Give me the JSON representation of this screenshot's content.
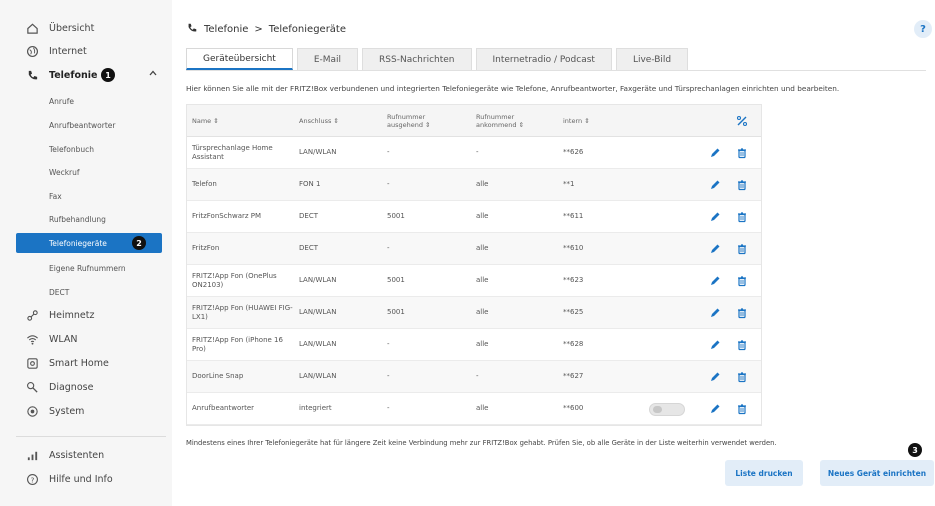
{
  "sidebar": {
    "items": [
      {
        "label": "Übersicht",
        "icon": "home-icon"
      },
      {
        "label": "Internet",
        "icon": "globe-icon"
      },
      {
        "label": "Telefonie",
        "icon": "phone-icon",
        "badge": "1"
      },
      {
        "label": "Heimnetz",
        "icon": "network-icon"
      },
      {
        "label": "WLAN",
        "icon": "wifi-icon"
      },
      {
        "label": "Smart Home",
        "icon": "smart-home-icon"
      },
      {
        "label": "Diagnose",
        "icon": "diagnose-icon"
      },
      {
        "label": "System",
        "icon": "system-icon"
      },
      {
        "label": "Assistenten",
        "icon": "assistant-icon"
      },
      {
        "label": "Hilfe und Info",
        "icon": "help-circle-icon"
      }
    ],
    "telefonie_sub": [
      {
        "label": "Anrufe"
      },
      {
        "label": "Anrufbeantworter"
      },
      {
        "label": "Telefonbuch"
      },
      {
        "label": "Weckruf"
      },
      {
        "label": "Fax"
      },
      {
        "label": "Rufbehandlung"
      },
      {
        "label": "Telefoniegeräte",
        "badge": "2"
      },
      {
        "label": "Eigene Rufnummern"
      },
      {
        "label": "DECT"
      }
    ]
  },
  "breadcrumb": {
    "section": "Telefonie",
    "separator": ">",
    "page": "Telefoniegeräte"
  },
  "help_label": "?",
  "tabs": [
    "Geräteübersicht",
    "E-Mail",
    "RSS-Nachrichten",
    "Internetradio / Podcast",
    "Live-Bild"
  ],
  "intro": "Hier können Sie alle mit der FRITZ!Box verbundenen und integrierten Telefoniegeräte wie Telefone, Anrufbeantworter, Faxgeräte und Türsprechanlagen einrichten und bearbeiten.",
  "table": {
    "headers": {
      "name": "Name ⇕",
      "anschluss": "Anschluss ⇕",
      "out": "Rufnummer ausgehend ⇕",
      "in": "Rufnummer ankommend ⇕",
      "intern": "intern ⇕"
    },
    "rows": [
      {
        "name": "Türsprechanlage Home Assistant",
        "anschluss": "LAN/WLAN",
        "out": "-",
        "in": "-",
        "intern": "**626"
      },
      {
        "name": "Telefon",
        "anschluss": "FON 1",
        "out": "-",
        "in": "alle",
        "intern": "**1"
      },
      {
        "name": "FritzFonSchwarz PM",
        "anschluss": "DECT",
        "out": "5001",
        "in": "alle",
        "intern": "**611"
      },
      {
        "name": "FritzFon",
        "anschluss": "DECT",
        "out": "-",
        "in": "alle",
        "intern": "**610"
      },
      {
        "name": "FRITZ!App Fon (OnePlus ON2103)",
        "anschluss": "LAN/WLAN",
        "out": "5001",
        "in": "alle",
        "intern": "**623"
      },
      {
        "name": "FRITZ!App Fon (HUAWEI FIG-LX1)",
        "anschluss": "LAN/WLAN",
        "out": "5001",
        "in": "alle",
        "intern": "**625"
      },
      {
        "name": "FRITZ!App Fon (iPhone 16 Pro)",
        "anschluss": "LAN/WLAN",
        "out": "-",
        "in": "alle",
        "intern": "**628"
      },
      {
        "name": "DoorLine Snap",
        "anschluss": "LAN/WLAN",
        "out": "-",
        "in": "-",
        "intern": "**627"
      },
      {
        "name": "Anrufbeantworter",
        "anschluss": "integriert",
        "out": "-",
        "in": "alle",
        "intern": "**600"
      }
    ]
  },
  "note": "Mindestens eines Ihrer Telefoniegeräte hat für längere Zeit keine Verbindung mehr zur FRITZ!Box gehabt. Prüfen Sie, ob alle Geräte in der Liste weiterhin verwendet werden.",
  "badge3": "3",
  "buttons": {
    "print": "Liste drucken",
    "new_device": "Neues Gerät einrichten"
  },
  "colors": {
    "accent": "#1b74c4",
    "accent_light": "#e2edf8"
  }
}
